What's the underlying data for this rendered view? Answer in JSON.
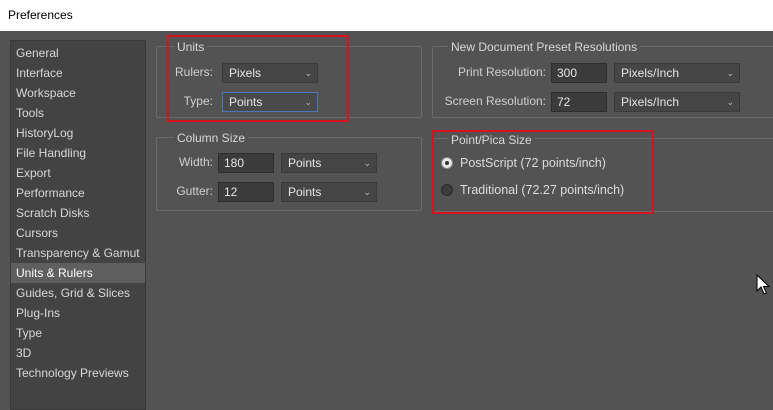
{
  "window": {
    "title": "Preferences"
  },
  "sidebar": {
    "items": [
      {
        "label": "General"
      },
      {
        "label": "Interface"
      },
      {
        "label": "Workspace"
      },
      {
        "label": "Tools"
      },
      {
        "label": "HistoryLog"
      },
      {
        "label": "File Handling"
      },
      {
        "label": "Export"
      },
      {
        "label": "Performance"
      },
      {
        "label": "Scratch Disks"
      },
      {
        "label": "Cursors"
      },
      {
        "label": "Transparency & Gamut"
      },
      {
        "label": "Units & Rulers"
      },
      {
        "label": "Guides, Grid & Slices"
      },
      {
        "label": "Plug-Ins"
      },
      {
        "label": "Type"
      },
      {
        "label": "3D"
      },
      {
        "label": "Technology Previews"
      }
    ],
    "selected": "Units & Rulers"
  },
  "units": {
    "title": "Units",
    "rulers_label": "Rulers:",
    "rulers_value": "Pixels",
    "type_label": "Type:",
    "type_value": "Points"
  },
  "column_size": {
    "title": "Column Size",
    "width_label": "Width:",
    "width_value": "180",
    "width_unit": "Points",
    "gutter_label": "Gutter:",
    "gutter_value": "12",
    "gutter_unit": "Points"
  },
  "presets": {
    "title": "New Document Preset Resolutions",
    "print_label": "Print Resolution:",
    "print_value": "300",
    "print_unit": "Pixels/Inch",
    "screen_label": "Screen Resolution:",
    "screen_value": "72",
    "screen_unit": "Pixels/Inch"
  },
  "pica": {
    "title": "Point/Pica Size",
    "postscript_label": "PostScript (72 points/inch)",
    "traditional_label": "Traditional (72.27 points/inch)",
    "selected": "PostScript (72 points/inch)"
  },
  "icons": {
    "dropdown": "chevron-down-icon",
    "cursor": "mouse-pointer-icon"
  },
  "colors": {
    "panel_bg": "#535353",
    "highlight_box": "#d4151d",
    "focus_border": "#4a78b4"
  }
}
